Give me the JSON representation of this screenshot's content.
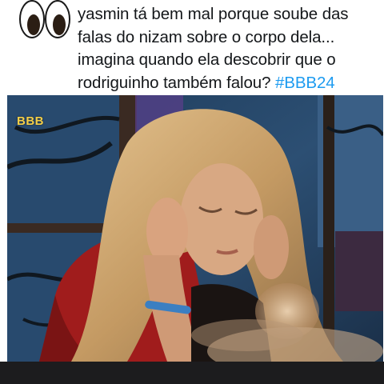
{
  "tweet": {
    "text": "yasmin tá bem mal porque soube das falas do nizam sobre o corpo dela... imagina quando ela descobrir que o rodriguinho também falou? ",
    "hashtag": "#BBB24"
  },
  "media": {
    "channel_logo": "BBB",
    "icon": "eyes-emoji-icon"
  },
  "colors": {
    "hashtag": "#1d9bf0",
    "logo": "#f4ce47"
  }
}
